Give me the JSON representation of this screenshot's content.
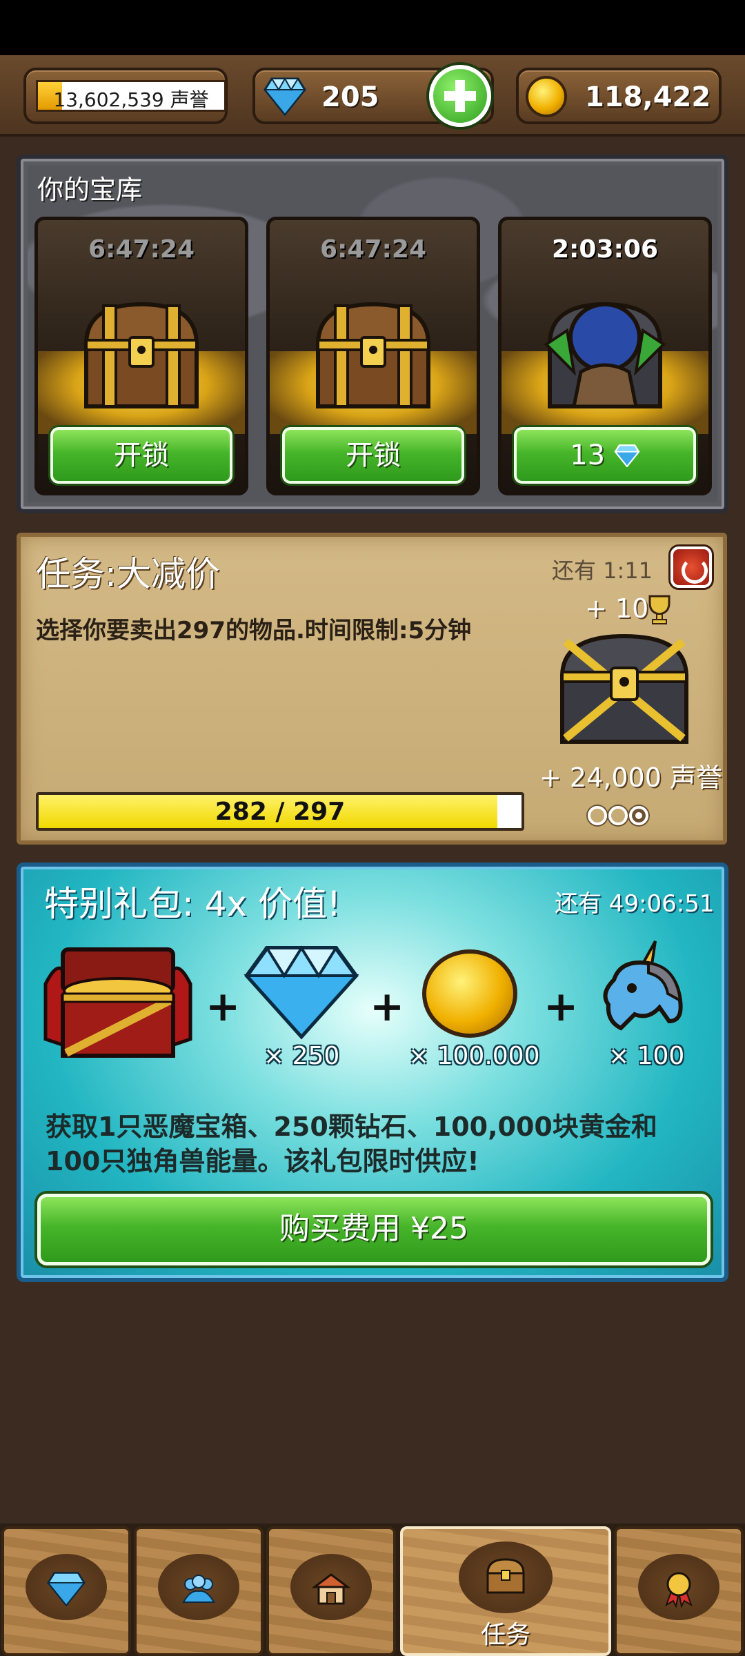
{
  "header": {
    "reputation_text": "13,602,539 声誉",
    "reputation_progress": 0.13,
    "gems": "205",
    "gold": "118,422"
  },
  "treasury": {
    "title": "你的宝库",
    "slots": [
      {
        "timer": "6:47:24",
        "button": "开锁",
        "active": false
      },
      {
        "timer": "6:47:24",
        "button": "开锁",
        "active": false
      },
      {
        "timer": "2:03:06",
        "button": "13",
        "active": true
      }
    ]
  },
  "quest": {
    "title": "任务:大减价",
    "time_left": "还有 1:11",
    "description": "选择你要卖出297的物品.时间限制:5分钟",
    "trophy_reward": "+ 10",
    "reputation_reward": "+ 24,000 声誉",
    "progress_text": "282 / 297",
    "progress_value": 282,
    "progress_max": 297,
    "steps_done": 1,
    "steps_total": 3
  },
  "pack": {
    "title": "特别礼包: 4x 价值!",
    "time_left": "还有 49:06:51",
    "items": [
      {
        "icon": "demon-chest-icon",
        "qty": ""
      },
      {
        "icon": "diamond-icon",
        "qty": "× 250"
      },
      {
        "icon": "gold-coin-icon",
        "qty": "× 100.000"
      },
      {
        "icon": "unicorn-icon",
        "qty": "× 100"
      }
    ],
    "description": "获取1只恶魔宝箱、250颗钻石、100,000块黄金和100只独角兽能量。该礼包限时供应!",
    "buy_label": "购买费用 ¥25"
  },
  "nav": {
    "tabs": [
      {
        "icon": "gem-icon",
        "label": ""
      },
      {
        "icon": "friends-icon",
        "label": ""
      },
      {
        "icon": "shop-icon",
        "label": ""
      },
      {
        "icon": "chest-icon",
        "label": "任务",
        "active": true
      },
      {
        "icon": "achievement-icon",
        "label": ""
      }
    ]
  },
  "colors": {
    "green_button": "#47b52a",
    "panel_parchment": "#c6aa74",
    "pack_teal": "#22b6c2",
    "progress_yellow": "#f0d800"
  }
}
